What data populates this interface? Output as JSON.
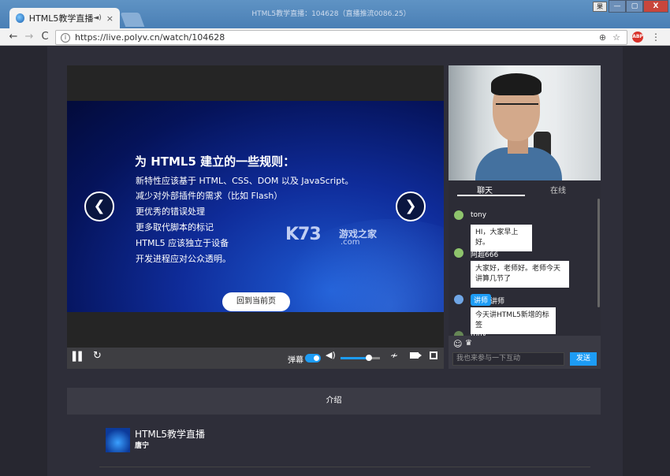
{
  "browser": {
    "tab_title": "HTML5教学直播",
    "window_title": "HTML5教学直播：104628（直播推流0086.25）",
    "url": "https://live.polyv.cn/watch/104628",
    "profile_label": "果",
    "back_icon": "←",
    "forward_icon": "→",
    "reload_icon": "C",
    "zoom_icon": "⊕",
    "star_icon": "☆",
    "menu_icon": "⋮",
    "abp_label": "ABP",
    "sound_icon": "◄)",
    "close_icon": "×",
    "min_icon": "—",
    "max_icon": "▢",
    "close_window_icon": "X"
  },
  "slide": {
    "title": "为 HTML5 建立的一些规则：",
    "lines": [
      "新特性应该基于 HTML、CSS、DOM 以及 JavaScript。",
      "减少对外部插件的需求（比如 Flash）",
      "更优秀的错误处理",
      "更多取代脚本的标记",
      "HTML5 应该独立于设备",
      "开发进程应对公众透明。"
    ],
    "back_to_page": "回到当前页",
    "prev_icon": "❮",
    "next_icon": "❯",
    "watermark_logo": "K73",
    "watermark_text": "游戏之家",
    "watermark_domain": ".com"
  },
  "controls": {
    "pause_icon": "▌▌",
    "refresh_icon": "↻",
    "danmu_label": "弹幕",
    "danmu_on": true,
    "volume_icon": "◀)",
    "volume_level": 0.72,
    "line_icon": "≁"
  },
  "chat": {
    "tabs": [
      "聊天",
      "在线"
    ],
    "messages": [
      {
        "user": "tony",
        "text": "HI，大家早上好。"
      },
      {
        "user": "阿超666",
        "text": "大家好，老师好。老师今天讲算几节了"
      },
      {
        "badge": "讲师",
        "user": "讲师",
        "text": "今天讲HTML5新增的标签"
      },
      {
        "user": "tony"
      }
    ],
    "emoji_icon": "☺",
    "gift_icon": "♛",
    "input_placeholder": "我也来参与一下互动",
    "send_label": "发送"
  },
  "intro": {
    "tab_label": "介绍",
    "title": "HTML5教学直播",
    "author": "唐宁"
  },
  "colors": {
    "accent": "#1d9cf5",
    "page_bg": "#272730",
    "panel_bg": "#2c2c36"
  }
}
